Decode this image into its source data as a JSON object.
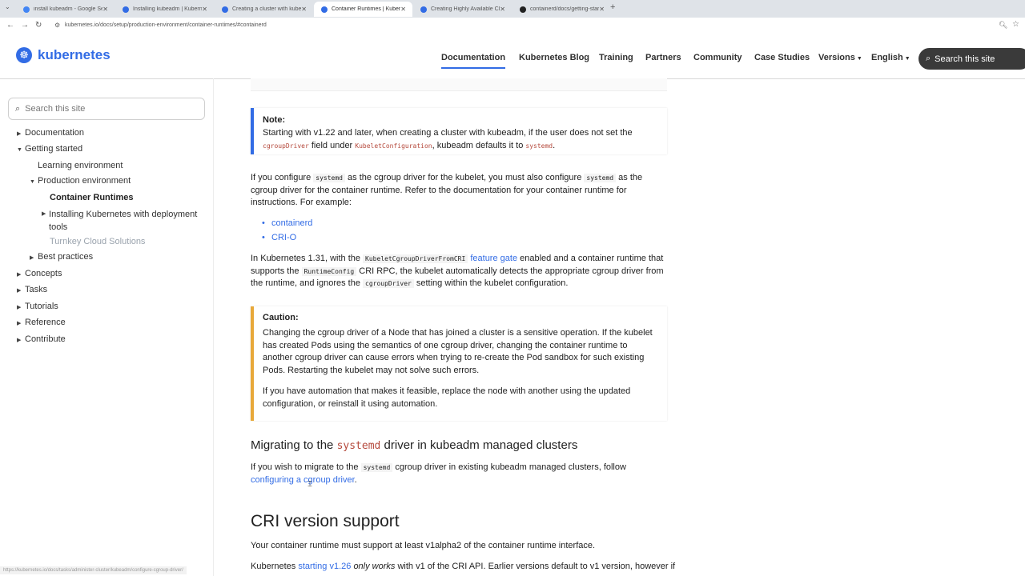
{
  "browser": {
    "tabs": [
      {
        "title": "install kubeadm - Google Search",
        "icon_color": "#4285f4",
        "active": false
      },
      {
        "title": "Installing kubeadm | Kubernetes",
        "icon_color": "#326ce5",
        "active": false
      },
      {
        "title": "Creating a cluster with kubeadm",
        "icon_color": "#326ce5",
        "active": false
      },
      {
        "title": "Container Runtimes | Kubernetes",
        "icon_color": "#326ce5",
        "active": true
      },
      {
        "title": "Creating Highly Available Clusters",
        "icon_color": "#326ce5",
        "active": false
      },
      {
        "title": "containerd/docs/getting-started",
        "icon_color": "#222222",
        "active": false
      }
    ],
    "new_tab": "+",
    "url": "kubernetes.io/docs/setup/production-environment/container-runtimes/#containerd",
    "status_url": "https://kubernetes.io/docs/tasks/administer-cluster/kubeadm/configure-cgroup-driver/"
  },
  "header": {
    "logo_text": "kubernetes",
    "nav": [
      {
        "label": "Documentation",
        "current": true,
        "caret": false
      },
      {
        "label": "Kubernetes Blog",
        "current": false,
        "caret": false
      },
      {
        "label": "Training",
        "current": false,
        "caret": false
      },
      {
        "label": "Partners",
        "current": false,
        "caret": false
      },
      {
        "label": "Community",
        "current": false,
        "caret": false
      },
      {
        "label": "Case Studies",
        "current": false,
        "caret": false
      },
      {
        "label": "Versions",
        "current": false,
        "caret": true
      },
      {
        "label": "English",
        "current": false,
        "caret": true
      }
    ],
    "search_placeholder": "Search this site"
  },
  "sidebar": {
    "search_placeholder": "Search this site",
    "items": [
      {
        "label": "Documentation",
        "level": 0,
        "toggle": "right",
        "state": "normal"
      },
      {
        "label": "Getting started",
        "level": 0,
        "toggle": "down",
        "state": "normal"
      },
      {
        "label": "Learning environment",
        "level": 1,
        "toggle": "none",
        "state": "normal"
      },
      {
        "label": "Production environment",
        "level": 1,
        "toggle": "down",
        "state": "normal"
      },
      {
        "label": "Container Runtimes",
        "level": 2,
        "toggle": "none",
        "state": "active"
      },
      {
        "label": "Installing Kubernetes with deployment tools",
        "level": 2,
        "toggle": "right",
        "state": "normal"
      },
      {
        "label": "Turnkey Cloud Solutions",
        "level": 2,
        "toggle": "none",
        "state": "muted"
      },
      {
        "label": "Best practices",
        "level": 1,
        "toggle": "right",
        "state": "normal"
      },
      {
        "label": "Concepts",
        "level": 0,
        "toggle": "right",
        "state": "normal"
      },
      {
        "label": "Tasks",
        "level": 0,
        "toggle": "right",
        "state": "normal"
      },
      {
        "label": "Tutorials",
        "level": 0,
        "toggle": "right",
        "state": "normal"
      },
      {
        "label": "Reference",
        "level": 0,
        "toggle": "right",
        "state": "normal"
      },
      {
        "label": "Contribute",
        "level": 0,
        "toggle": "right",
        "state": "normal"
      }
    ]
  },
  "content": {
    "note": {
      "title": "Note:",
      "t1": "Starting with v1.22 and later, when creating a cluster with kubeadm, if the user does not set the",
      "c1": "cgroupDriver",
      "t2": " field under ",
      "c2": "KubeletConfiguration",
      "t3": ", kubeadm defaults it to ",
      "c3": "systemd",
      "t4": "."
    },
    "p1": {
      "t1": "If you configure ",
      "c1": "systemd",
      "t2": " as the cgroup driver for the kubelet, you must also configure ",
      "c2": "systemd",
      "t3": " as the cgroup driver for the container runtime. Refer to the documentation for your container runtime for instructions. For example:"
    },
    "bullets": [
      "containerd",
      "CRI-O"
    ],
    "p2": {
      "t1": "In Kubernetes 1.31, with the ",
      "c1": "KubeletCgroupDriverFromCRI",
      "link": "feature gate",
      "t2": " enabled and a container runtime that supports the ",
      "c2": "RuntimeConfig",
      "t3": " CRI RPC, the kubelet automatically detects the appropriate cgroup driver from the runtime, and ignores the ",
      "c3": "cgroupDriver",
      "t4": " setting within the kubelet configuration."
    },
    "caution": {
      "title": "Caution:",
      "p1": "Changing the cgroup driver of a Node that has joined a cluster is a sensitive operation. If the kubelet has created Pods using the semantics of one cgroup driver, changing the container runtime to another cgroup driver can cause errors when trying to re-create the Pod sandbox for such existing Pods. Restarting the kubelet may not solve such errors.",
      "p2": "If you have automation that makes it feasible, replace the node with another using the updated configuration, or reinstall it using automation."
    },
    "migrate": {
      "h_pre": "Migrating to the ",
      "h_code": "systemd",
      "h_post": " driver in kubeadm managed clusters",
      "t1": "If you wish to migrate to the ",
      "c1": "systemd",
      "t2": " cgroup driver in existing kubeadm managed clusters, follow ",
      "link": "configuring a cgroup driver",
      "t3": "."
    },
    "cri": {
      "heading": "CRI version support",
      "p1": "Your container runtime must support at least v1alpha2 of the container runtime interface.",
      "t1": "Kubernetes ",
      "link": "starting v1.26",
      "em": "only works",
      "t2": " with v1 of the CRI API. Earlier versions default to v1 version, however if"
    }
  },
  "colors": {
    "brand": "#326ce5",
    "note_bar": "#326ce5",
    "caution_bar": "#e8a93a",
    "code_red": "#b5493c"
  }
}
